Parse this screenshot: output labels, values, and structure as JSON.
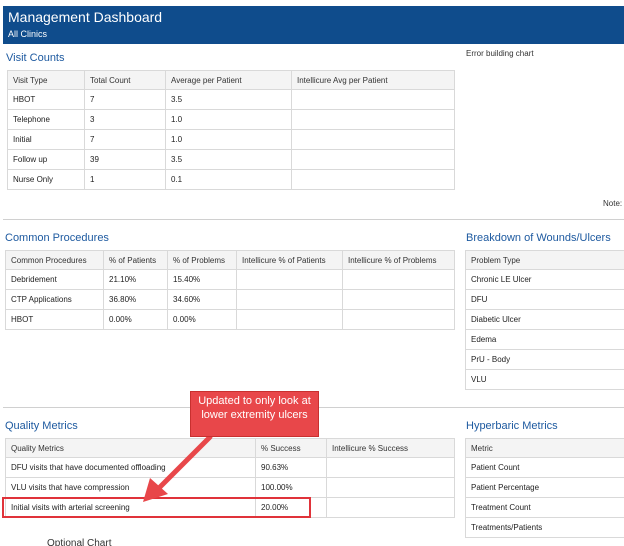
{
  "header": {
    "title": "Management Dashboard",
    "subtitle": "All Clinics"
  },
  "visit_counts": {
    "title": "Visit Counts",
    "columns": [
      "Visit Type",
      "Total Count",
      "Average per Patient",
      "Intellicure Avg per Patient"
    ],
    "rows": [
      [
        "HBOT",
        "7",
        "3.5",
        ""
      ],
      [
        "Telephone",
        "3",
        "1.0",
        ""
      ],
      [
        "Initial",
        "7",
        "1.0",
        ""
      ],
      [
        "Follow up",
        "39",
        "3.5",
        ""
      ],
      [
        "Nurse Only",
        "1",
        "0.1",
        ""
      ]
    ]
  },
  "chart_error": "Error building chart",
  "note_label": "Note:",
  "common_procedures": {
    "title": "Common Procedures",
    "columns": [
      "Common Procedures",
      "% of Patients",
      "% of Problems",
      "Intellicure % of Patients",
      "Intellicure % of Problems"
    ],
    "rows": [
      [
        "Debridement",
        "21.10%",
        "15.40%",
        "",
        ""
      ],
      [
        "CTP Applications",
        "36.80%",
        "34.60%",
        "",
        ""
      ],
      [
        "HBOT",
        "0.00%",
        "0.00%",
        "",
        ""
      ]
    ]
  },
  "wounds": {
    "title": "Breakdown of Wounds/Ulcers",
    "columns": [
      "Problem Type"
    ],
    "rows": [
      [
        "Chronic LE Ulcer"
      ],
      [
        "DFU"
      ],
      [
        "Diabetic Ulcer"
      ],
      [
        "Edema"
      ],
      [
        "PrU - Body"
      ],
      [
        "VLU"
      ]
    ]
  },
  "quality_metrics": {
    "title": "Quality Metrics",
    "columns": [
      "Quality Metrics",
      "% Success",
      "Intellicure % Success"
    ],
    "rows": [
      [
        "DFU visits that have documented offloading",
        "90.63%",
        ""
      ],
      [
        "VLU visits that have compression",
        "100.00%",
        ""
      ],
      [
        "Initial visits with arterial screening",
        "20.00%",
        ""
      ]
    ]
  },
  "hyperbaric_metrics": {
    "title": "Hyperbaric Metrics",
    "columns": [
      "Metric"
    ],
    "rows": [
      [
        "Patient Count"
      ],
      [
        "Patient Percentage"
      ],
      [
        "Treatment Count"
      ],
      [
        "Treatments/Patients"
      ]
    ]
  },
  "callout": {
    "text": "Updated to only look at lower extremity ulcers"
  },
  "bottom_cut_text": "Optional Chart",
  "colors": {
    "header_bg": "#0f4c8c",
    "title_blue": "#1e5aa0",
    "callout_red": "#e8474a",
    "highlight_red": "#e0333a"
  }
}
